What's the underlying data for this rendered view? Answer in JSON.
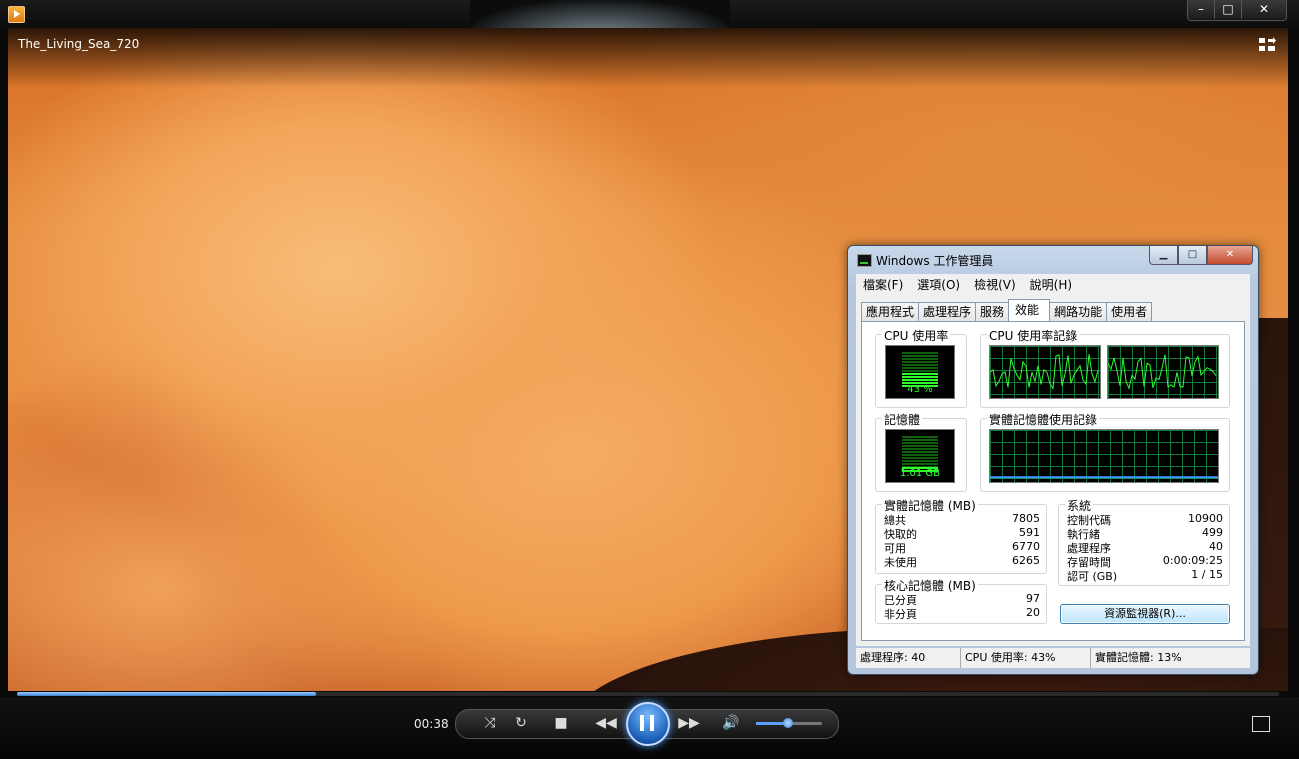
{
  "player": {
    "video_title": "The_Living_Sea_720",
    "current_time": "00:38",
    "progress": 0.237,
    "volume": 0.48,
    "window_buttons": {
      "minimize": "–",
      "maximize": "□",
      "close": "✕"
    }
  },
  "taskmanager": {
    "title": "Windows 工作管理員",
    "menu": [
      "檔案(F)",
      "選項(O)",
      "檢視(V)",
      "說明(H)"
    ],
    "tabs": [
      "應用程式",
      "處理程序",
      "服務",
      "效能",
      "網路功能",
      "使用者"
    ],
    "active_tab": "效能",
    "cpu_usage_label": "CPU 使用率",
    "cpu_usage_value": "43 %",
    "cpu_usage_fraction": 0.43,
    "cpu_history_label": "CPU 使用率記錄",
    "memory_label": "記憶體",
    "memory_value": "1.01 GB",
    "memory_fraction": 0.13,
    "memory_history_label": "實體記憶體使用記錄",
    "physical_memory": {
      "title": "實體記憶體 (MB)",
      "rows": [
        {
          "k": "總共",
          "v": "7805"
        },
        {
          "k": "快取的",
          "v": "591"
        },
        {
          "k": "可用",
          "v": "6770"
        },
        {
          "k": "未使用",
          "v": "6265"
        }
      ]
    },
    "system": {
      "title": "系統",
      "rows": [
        {
          "k": "控制代碼",
          "v": "10900"
        },
        {
          "k": "執行緒",
          "v": "499"
        },
        {
          "k": "處理程序",
          "v": "40"
        },
        {
          "k": "存留時間",
          "v": "0:00:09:25"
        },
        {
          "k": "認可 (GB)",
          "v": "1 / 15"
        }
      ]
    },
    "kernel_memory": {
      "title": "核心記憶體 (MB)",
      "rows": [
        {
          "k": "已分頁",
          "v": "97"
        },
        {
          "k": "非分頁",
          "v": "20"
        }
      ]
    },
    "resource_monitor_button": "資源監視器(R)...",
    "status": {
      "processes": "處理程序: 40",
      "cpu": "CPU 使用率: 43%",
      "memory": "實體記憶體: 13%"
    }
  }
}
